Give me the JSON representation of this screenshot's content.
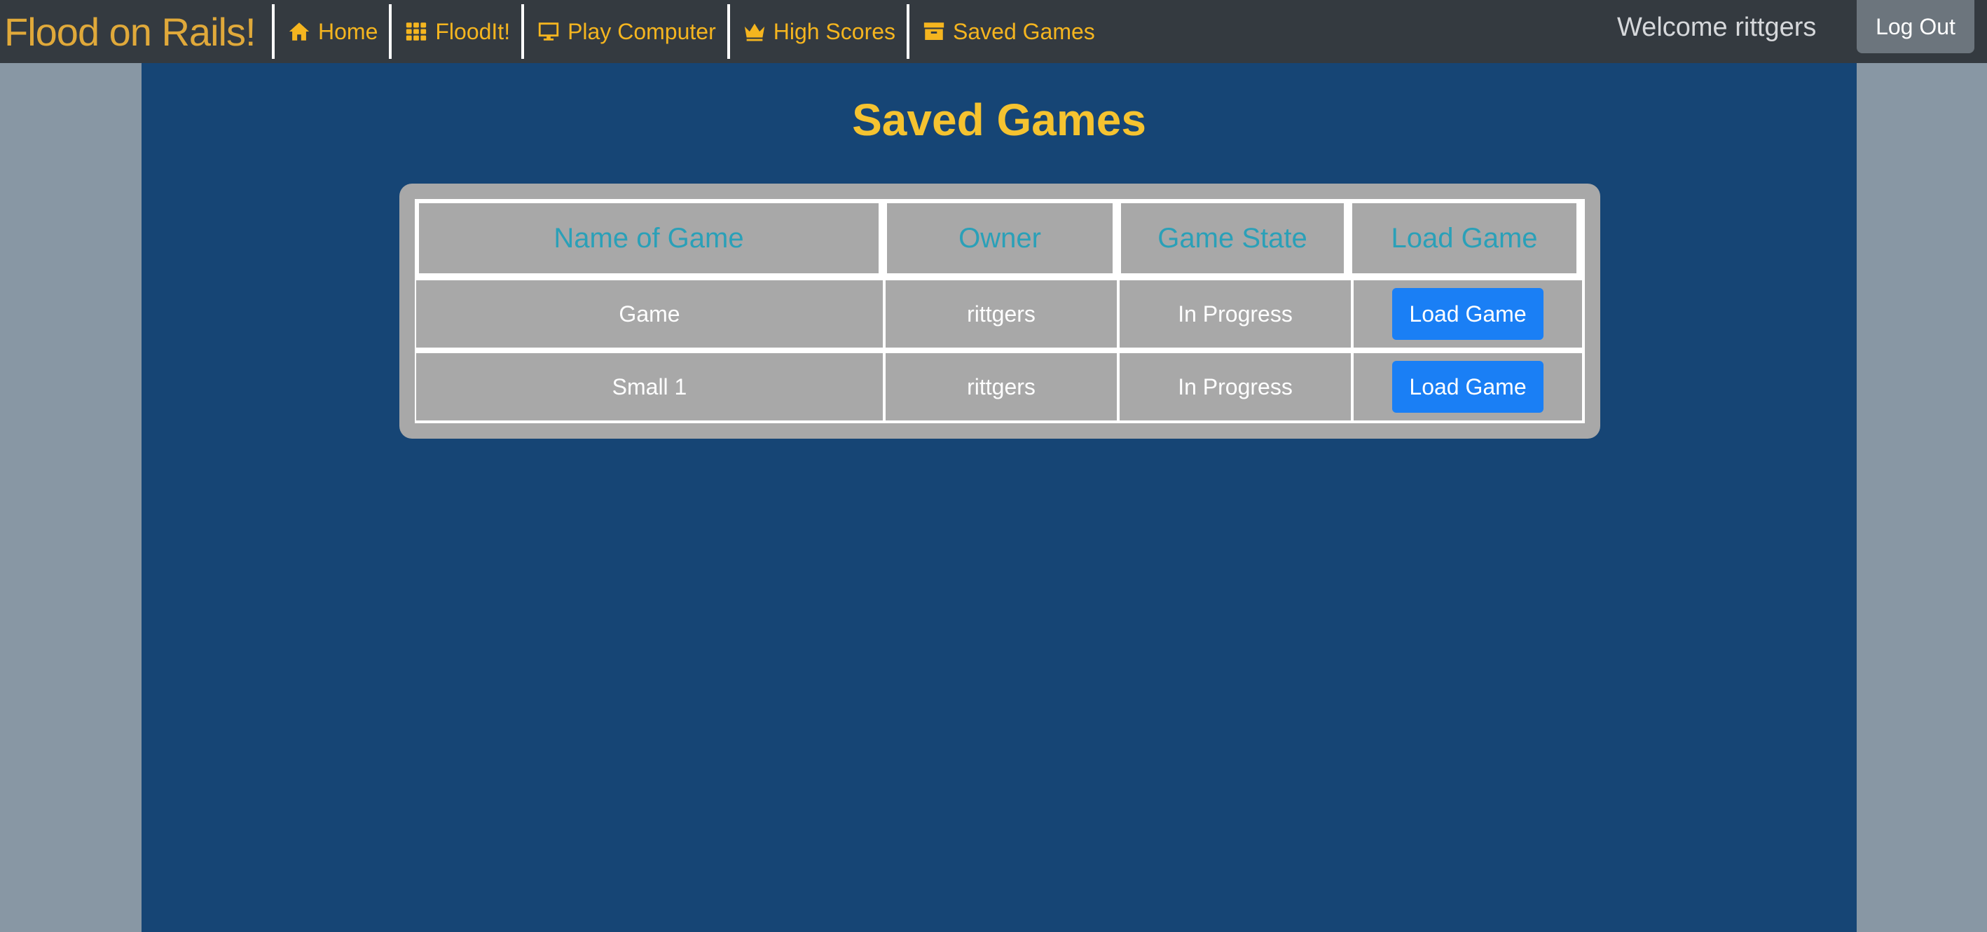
{
  "navbar": {
    "brand": "Flood on Rails!",
    "items": [
      {
        "label": "Home",
        "icon": "home-icon"
      },
      {
        "label": "FloodIt!",
        "icon": "grid-icon"
      },
      {
        "label": "Play Computer",
        "icon": "desktop-icon"
      },
      {
        "label": "High Scores",
        "icon": "crown-icon"
      },
      {
        "label": "Saved Games",
        "icon": "archive-icon"
      }
    ],
    "welcome": "Welcome rittgers",
    "logout_label": "Log Out"
  },
  "page": {
    "title": "Saved Games"
  },
  "table": {
    "headers": [
      "Name of Game",
      "Owner",
      "Game State",
      "Load Game"
    ],
    "rows": [
      {
        "name": "Game",
        "owner": "rittgers",
        "state": "In Progress",
        "action": "Load Game"
      },
      {
        "name": "Small 1",
        "owner": "rittgers",
        "state": "In Progress",
        "action": "Load Game"
      }
    ]
  },
  "colors": {
    "navbar": "#343a40",
    "brand": "#e0a93a",
    "nav_link": "#f5b51f",
    "page_bg": "#8897a4",
    "main_bg": "#164575",
    "title": "#f5c330",
    "table_cell": "#a8a8a8",
    "header_text": "#2aa0b8",
    "button": "#1a7ff5"
  }
}
